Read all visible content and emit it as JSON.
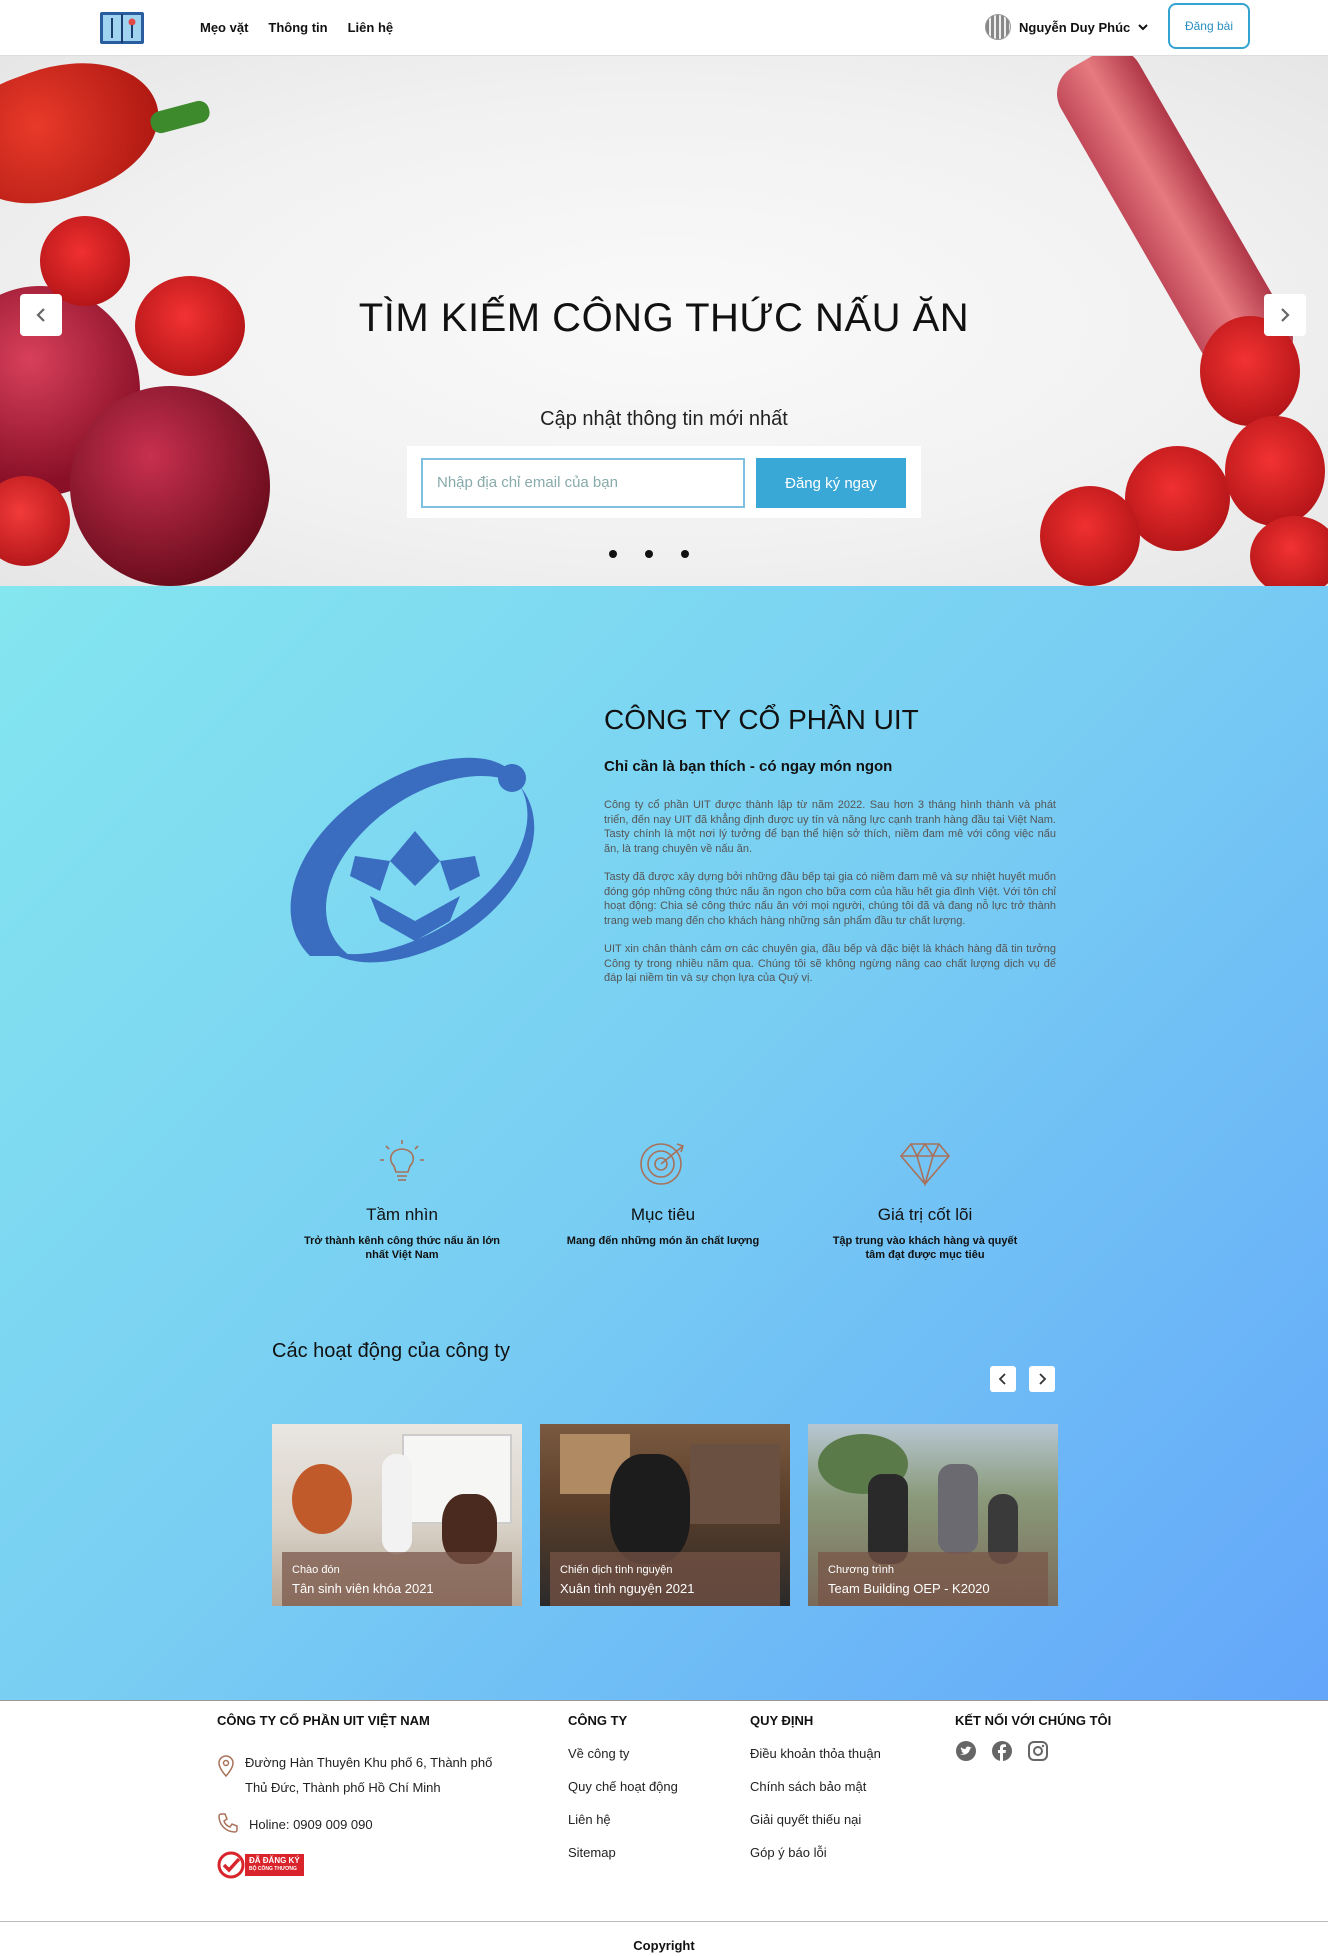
{
  "header": {
    "nav": [
      "Mẹo vặt",
      "Thông tin",
      "Liên hệ"
    ],
    "user_name": "Nguyễn Duy Phúc",
    "post_button": "Đăng bài"
  },
  "hero": {
    "title": "TÌM KIẾM CÔNG THỨC NẤU ĂN",
    "subtitle": "Cập nhật thông tin mới nhất",
    "email_placeholder": "Nhập địa chỉ email của bạn",
    "subscribe_button": "Đăng ký ngay",
    "slides": 3
  },
  "about": {
    "title": "CÔNG TY CỔ PHẦN UIT",
    "slogan": "Chỉ cần là bạn thích - có ngay món ngon",
    "paragraphs": [
      "Công ty cổ phần UIT được thành lập từ năm 2022. Sau hơn 3 tháng hình thành và phát triển, đến nay UIT đã khẳng định được uy tín và năng lực cạnh tranh hàng đầu tại Việt Nam. Tasty chính là một nơi lý tưởng để bạn thể hiện sở thích, niềm đam mê với công việc nấu ăn, là trang chuyên về nấu ăn.",
      "Tasty đã được xây dựng bởi những đầu bếp tại gia có niềm đam mê và sự nhiệt huyết muốn đóng góp những công thức nấu ăn ngon cho bữa cơm của hầu hết gia đình Việt. Với tôn chỉ hoạt động: Chia sẻ công thức nấu ăn với mọi người, chúng tôi đã và đang nỗ lực trở thành trang web mang đến cho khách hàng những sản phẩm đầu tư chất lượng.",
      "UIT xin chân thành cảm ơn các chuyên gia, đầu bếp và đặc biệt là khách hàng đã tin tưởng Công ty trong nhiều năm qua. Chúng tôi sẽ không ngừng nâng cao chất lượng dịch vụ để đáp lại niềm tin và sự chọn lựa của Quý vị."
    ],
    "values": [
      {
        "icon": "lightbulb-icon",
        "title": "Tầm nhìn",
        "text": "Trở thành kênh công thức nấu ăn lớn nhất Việt Nam"
      },
      {
        "icon": "target-icon",
        "title": "Mục tiêu",
        "text": "Mang đến những món ăn chất lượng"
      },
      {
        "icon": "diamond-icon",
        "title": "Giá trị cốt lõi",
        "text": "Tập trung vào khách hàng và quyết tâm đạt được mục tiêu"
      }
    ],
    "activities_title": "Các hoạt động của công ty",
    "activities": [
      {
        "label": "Chào đón",
        "title": "Tân sinh viên khóa 2021"
      },
      {
        "label": "Chiến dịch tình nguyện",
        "title": "Xuân tình nguyện 2021"
      },
      {
        "label": "Chương trình",
        "title": "Team Building OEP - K2020"
      }
    ]
  },
  "footer": {
    "company": {
      "title": "CÔNG TY CỔ PHẦN UIT VIỆT NAM",
      "address": "Đường Hàn Thuyên Khu phố 6, Thành phố Thủ Đức, Thành phố Hồ Chí Minh",
      "hotline": "Holine: 0909 009 090",
      "badge": "ĐÃ ĐĂNG KÝ",
      "badge_sub": "BỘ CÔNG THƯƠNG"
    },
    "cong_ty": {
      "title": "CÔNG TY",
      "links": [
        "Về công ty",
        "Quy chế hoạt động",
        "Liên hệ",
        "Sitemap"
      ]
    },
    "quy_dinh": {
      "title": "QUY ĐỊNH",
      "links": [
        "Điều khoản thỏa thuận",
        "Chính sách bảo mật",
        "Giải quyết thiếu nại",
        "Góp ý báo lỗi"
      ]
    },
    "social": {
      "title": "KẾT NỐI VỚI CHÚNG TÔI",
      "icons": [
        "twitter-icon",
        "facebook-icon",
        "instagram-icon"
      ]
    },
    "copyright": "Copyright"
  }
}
